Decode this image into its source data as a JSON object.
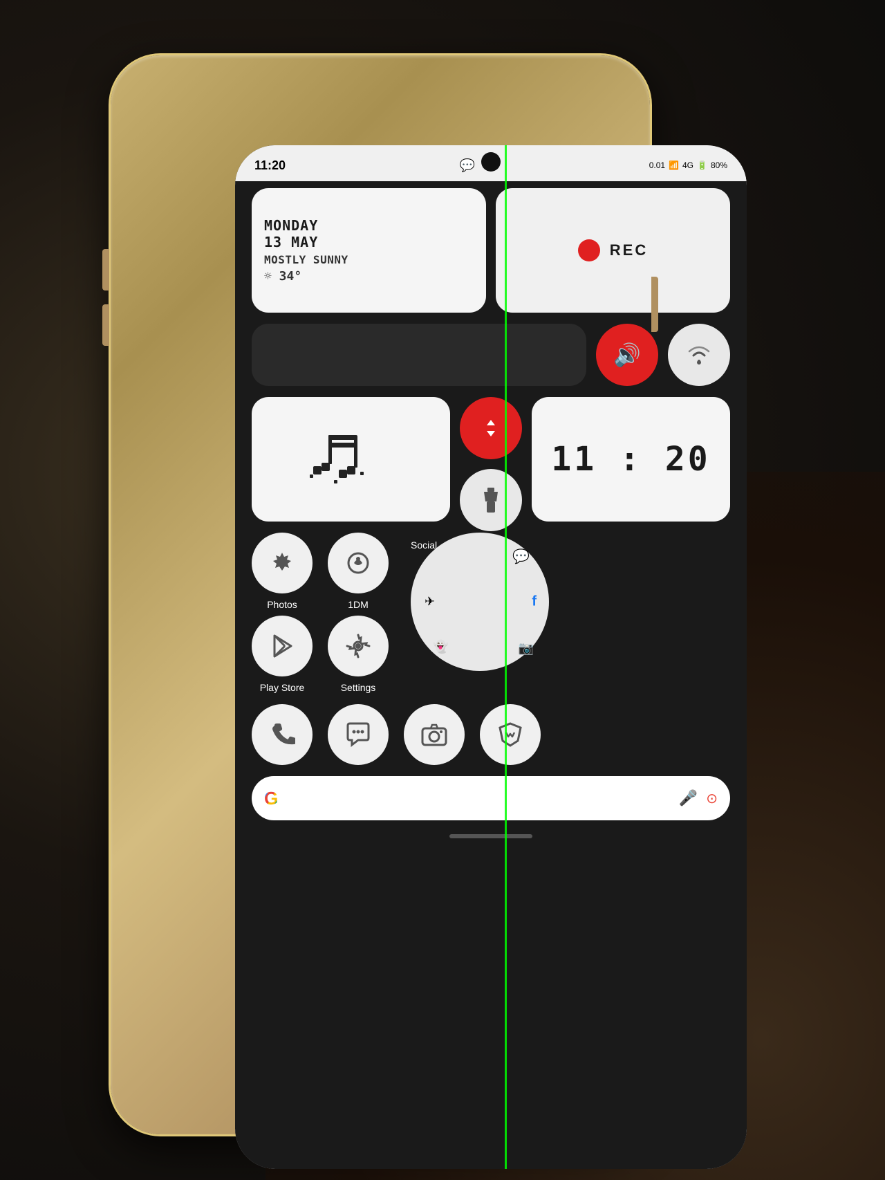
{
  "scene": {
    "background": "#1a1a1a"
  },
  "status_bar": {
    "time": "11:20",
    "whatsapp": "💬",
    "signal_info": "0.01",
    "network": "4G",
    "battery": "80%"
  },
  "weather_widget": {
    "day": "MONDAY",
    "date": "13 MAY",
    "description": "MOSTLY SUNNY",
    "temp": "☼ 34°"
  },
  "rec_widget": {
    "label": "REC"
  },
  "controls": {
    "sound_icon": "🔊",
    "wifi_icon": "▽",
    "data_icon": "↕",
    "torch_icon": "🔦"
  },
  "music_widget": {
    "note": "♫"
  },
  "clock_widget": {
    "time": "11 : 20"
  },
  "apps": {
    "row1": [
      {
        "name": "photos",
        "label": "Photos",
        "icon": "❀"
      },
      {
        "name": "1dm",
        "label": "1DM",
        "icon": "☁"
      },
      {
        "name": "play_store",
        "label": "Play Store",
        "icon": "▷"
      },
      {
        "name": "settings",
        "label": "Settings",
        "icon": "⚙"
      }
    ],
    "social": {
      "label": "Social",
      "icons": {
        "whatsapp": "💬",
        "telegram": "✈",
        "facebook": "f",
        "snapchat": "👻",
        "instagram": "📷"
      }
    },
    "row2": [
      {
        "name": "phone",
        "label": "",
        "icon": "📞"
      },
      {
        "name": "chat",
        "label": "",
        "icon": "💬"
      },
      {
        "name": "camera",
        "label": "",
        "icon": "📷"
      },
      {
        "name": "brave",
        "label": "",
        "icon": "🦁"
      }
    ]
  },
  "search_bar": {
    "g_letter": "G",
    "mic_icon": "🎤",
    "lens_icon": "⊙"
  }
}
